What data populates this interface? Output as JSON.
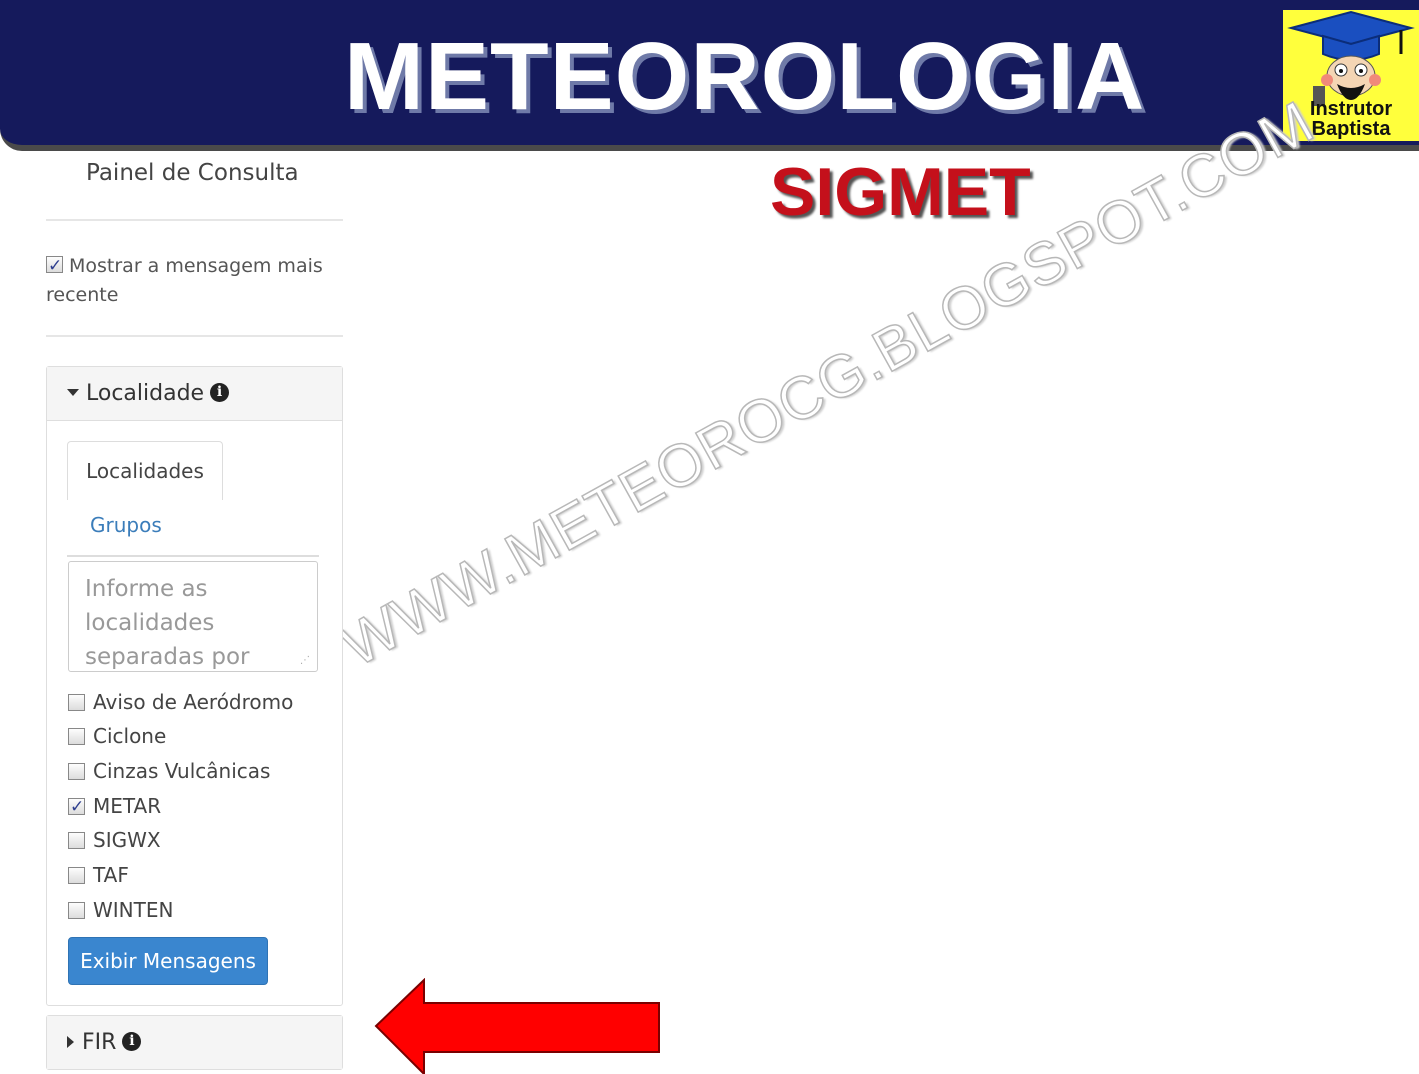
{
  "banner": {
    "title": "METEOROLOGIA",
    "logo_line1": "Instrutor",
    "logo_line2": "Baptista",
    "bg_color": "#151a5c"
  },
  "subtitle": "SIGMET",
  "panel": {
    "title": "Painel de Consulta",
    "show_recent_label": "Mostrar a mensagem mais recente",
    "show_recent_checked": true
  },
  "localidade": {
    "header": "Localidade",
    "tabs": [
      {
        "label": "Localidades",
        "active": true
      },
      {
        "label": "Grupos",
        "active": false
      }
    ],
    "textarea_placeholder": "Informe as localidades separadas por",
    "options": [
      {
        "label": "Aviso de Aeródromo",
        "checked": false
      },
      {
        "label": "Ciclone",
        "checked": false
      },
      {
        "label": "Cinzas Vulcânicas",
        "checked": false
      },
      {
        "label": "METAR",
        "checked": true
      },
      {
        "label": "SIGWX",
        "checked": false
      },
      {
        "label": "TAF",
        "checked": false
      },
      {
        "label": "WINTEN",
        "checked": false
      }
    ],
    "button_label": "Exibir Mensagens"
  },
  "fir": {
    "header": "FIR"
  },
  "watermark": "WWW.METEOROCG.BLOGSPOT.COM",
  "colors": {
    "accent": "#3a86cf",
    "subtitle": "#c4101b",
    "arrow": "#ff0000",
    "logo_bg": "#ffff3c"
  }
}
